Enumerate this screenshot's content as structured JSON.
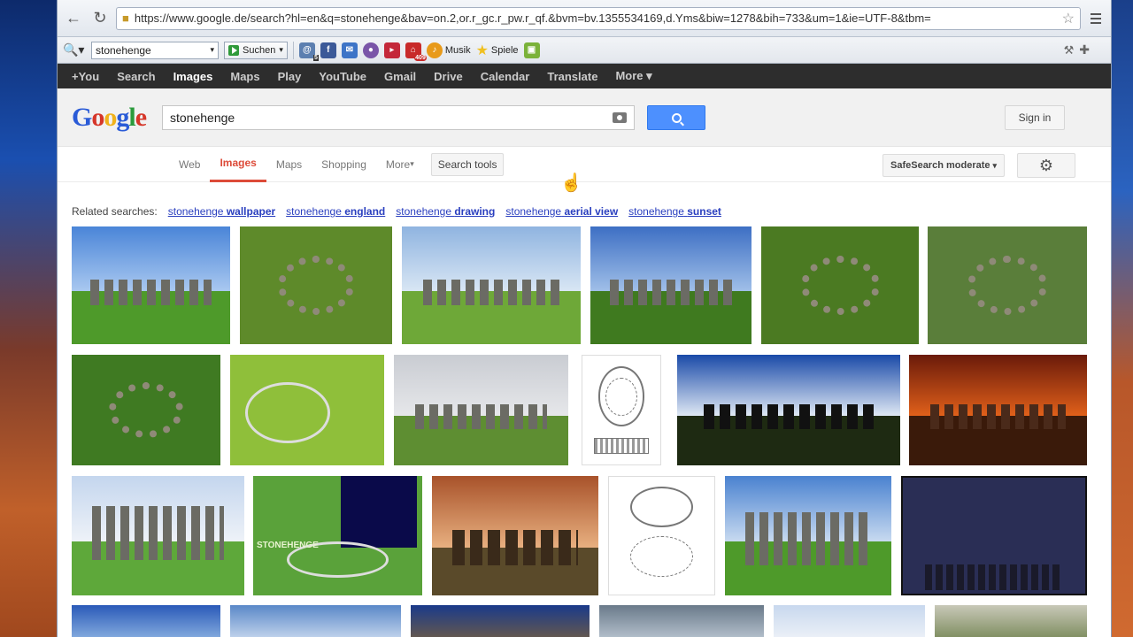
{
  "browser": {
    "url": "https://www.google.de/search?hl=en&q=stonehenge&bav=on.2,or.r_gc.r_pw.r_qf.&bvm=bv.1355534169,d.Yms&biw=1278&bih=733&um=1&ie=UTF-8&tbm="
  },
  "toolbar": {
    "search_value": "stonehenge",
    "search_button": "Suchen",
    "badge_5": "5",
    "badge_409": "409",
    "musik": "Musik",
    "spiele": "Spiele"
  },
  "gbar": {
    "items": [
      "+You",
      "Search",
      "Images",
      "Maps",
      "Play",
      "YouTube",
      "Gmail",
      "Drive",
      "Calendar",
      "Translate",
      "More ▾"
    ]
  },
  "header": {
    "logo": [
      "G",
      "o",
      "o",
      "g",
      "l",
      "e"
    ],
    "query": "stonehenge",
    "sign_in": "Sign in"
  },
  "tabs": {
    "web": "Web",
    "images": "Images",
    "maps": "Maps",
    "shopping": "Shopping",
    "more": "More",
    "search_tools": "Search tools",
    "safesearch": "SafeSearch moderate"
  },
  "related": {
    "label": "Related searches:",
    "items": [
      {
        "prefix": "stonehenge",
        "bold": "wallpaper"
      },
      {
        "prefix": "stonehenge",
        "bold": "england"
      },
      {
        "prefix": "stonehenge",
        "bold": "drawing"
      },
      {
        "prefix": "stonehenge",
        "bold": "aerial view"
      },
      {
        "prefix": "stonehenge",
        "bold": "sunset"
      }
    ]
  },
  "results": {
    "diagram_label": "STONEHENGE"
  },
  "colors": {
    "accent": "#dd4b39",
    "link": "#2a3fbf",
    "search_button": "#4d90fe",
    "gbar": "#2d2d2d"
  }
}
